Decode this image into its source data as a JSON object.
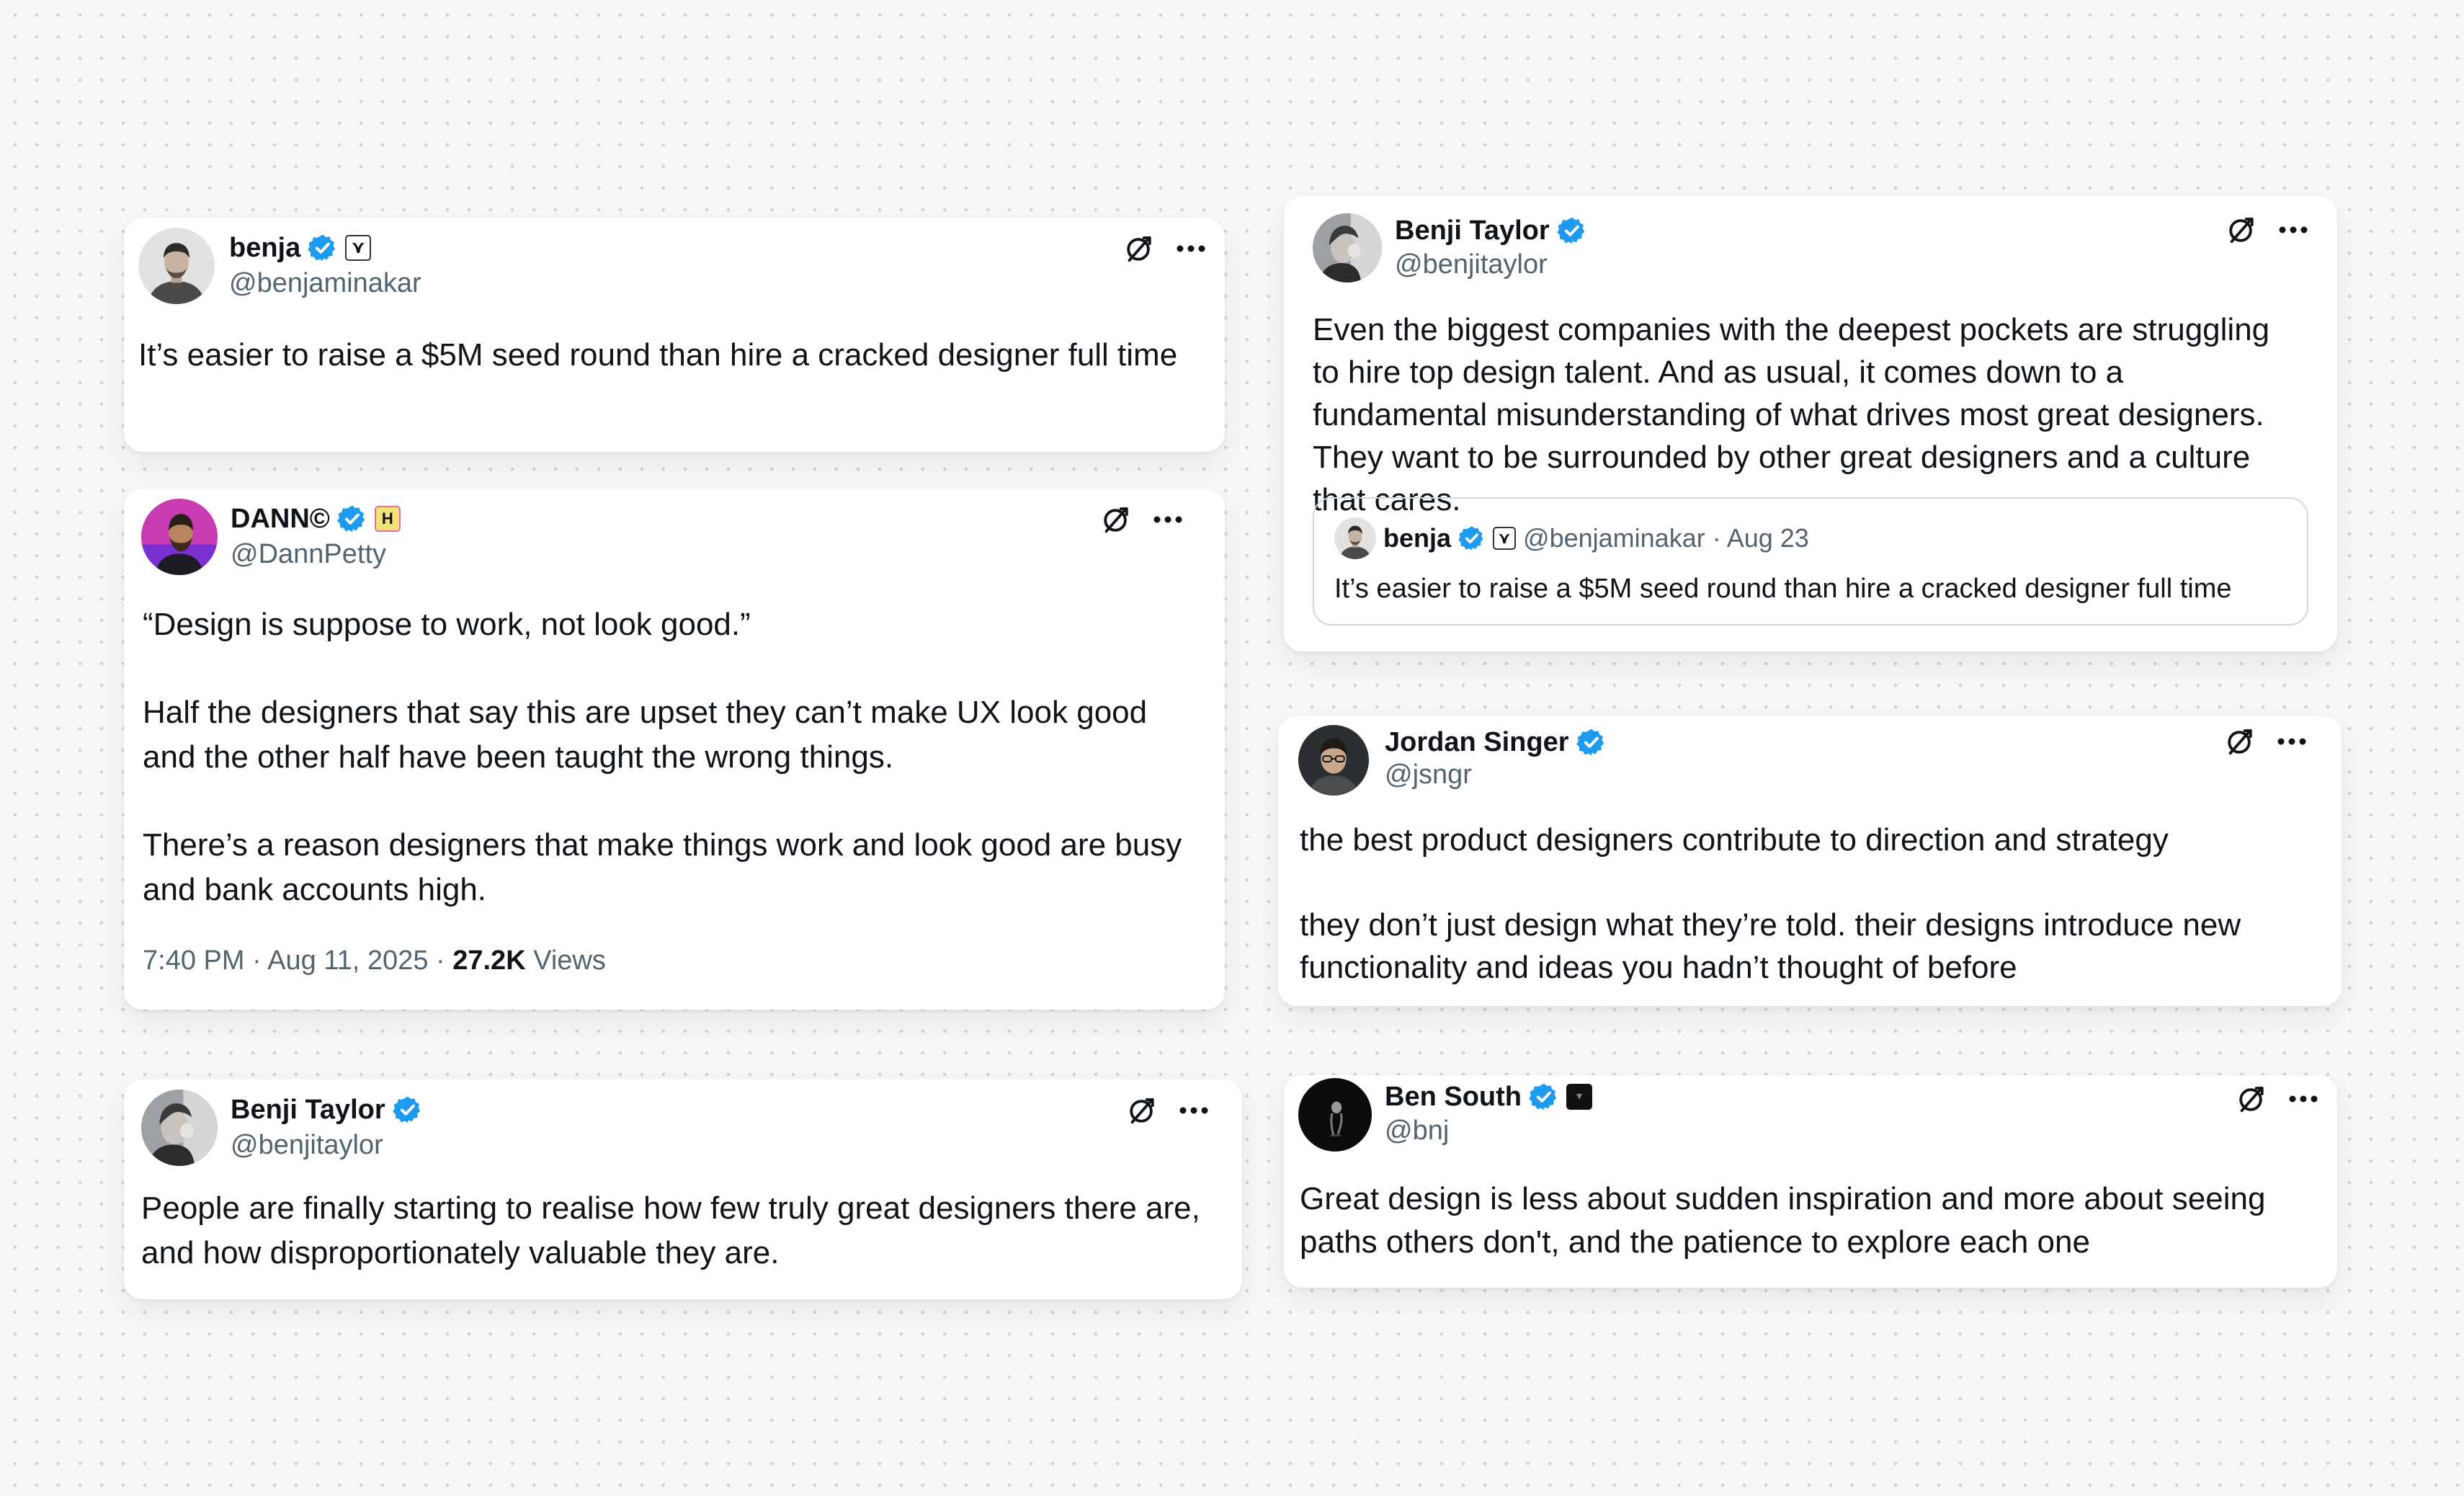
{
  "colors": {
    "verified": "#1d9bf0",
    "text": "#0f1419",
    "secondary": "#536471",
    "background": "#f7f7f7"
  },
  "icons": {
    "verified": "verified-badge-icon",
    "grok": "grok-icon",
    "more": "more-options-icon"
  },
  "tweets": [
    {
      "author": "benja",
      "handle": "@benjaminakar",
      "affiliate": "x-glyph",
      "paragraphs": [
        "It’s easier to raise a $5M seed round than hire a cracked designer full time"
      ]
    },
    {
      "author": "DANN©",
      "handle": "@DannPetty",
      "affiliate": "H",
      "paragraphs": [
        "“Design is suppose to work, not look good.”",
        "Half the designers that say this are upset they can’t make UX look good and the other half have been taught the wrong things.",
        "There’s a reason designers that make things work and look good are busy and bank accounts high."
      ],
      "time": "7:40 PM · Aug 11, 2025 · ",
      "views_count": "27.2K",
      "views_label": " Views"
    },
    {
      "author": "Benji Taylor",
      "handle": "@benjitaylor",
      "paragraphs": [
        "People are finally starting to realise how few truly great designers there are, and how disproportionately valuable they are."
      ]
    },
    {
      "author": "Benji Taylor",
      "handle": "@benjitaylor",
      "paragraphs": [
        "Even the biggest companies with the deepest pockets are struggling to hire top design talent. And as usual, it comes down to a fundamental misunderstanding of what drives most great designers. They want to be surrounded by other great designers and a culture that cares."
      ],
      "quote": {
        "author": "benja",
        "handle": "@benjaminakar",
        "date": "· Aug 23",
        "text": "It’s easier to raise a $5M seed round than hire a cracked designer full time"
      }
    },
    {
      "author": "Jordan Singer",
      "handle": "@jsngr",
      "paragraphs": [
        "the best product designers contribute to direction and strategy",
        "they don’t just design what they’re told. their designs introduce new functionality and ideas you hadn’t thought of before"
      ]
    },
    {
      "author": "Ben South",
      "handle": "@bnj",
      "affiliate": "dark-badge",
      "paragraphs": [
        "Great design is less about sudden inspiration and more about seeing paths others don't, and the patience to explore each one"
      ]
    }
  ]
}
